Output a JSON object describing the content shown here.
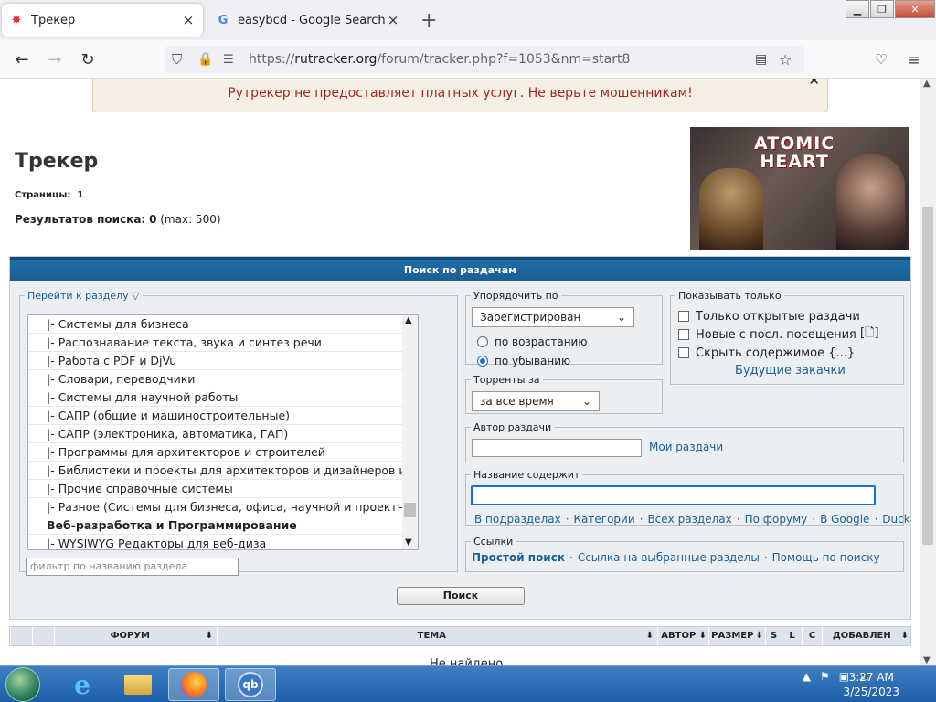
{
  "tabs": [
    {
      "title": "Трекер",
      "active": true
    },
    {
      "title": "easybcd - Google Search",
      "active": false
    }
  ],
  "address": {
    "prefix": "https://",
    "host": "rutracker.org",
    "path": "/forum/tracker.php?f=1053&nm=start8"
  },
  "notice": "Рутрекер не предоставляет платных услуг. Не верьте мошенникам!",
  "page": {
    "title": "Трекер",
    "pages_label": "Страницы:",
    "pages_value": "1",
    "results_label": "Результатов поиска:",
    "results_value": "0",
    "results_max": "(max: 500)"
  },
  "banner": {
    "line1": "ATOMIC",
    "line2": "HEART"
  },
  "search": {
    "header": "Поиск по раздачам",
    "goto_section": "Перейти к разделу",
    "forums": [
      {
        "label": "|- Системы для бизнеса",
        "cat": false
      },
      {
        "label": "|- Распознавание текста, звука и синтез речи",
        "cat": false
      },
      {
        "label": "|- Работа с PDF и DjVu",
        "cat": false
      },
      {
        "label": "|- Словари, переводчики",
        "cat": false
      },
      {
        "label": "|- Системы для научной работы",
        "cat": false
      },
      {
        "label": "|- САПР (общие и машиностроительные)",
        "cat": false
      },
      {
        "label": "|- САПР (электроника, автоматика, ГАП)",
        "cat": false
      },
      {
        "label": "|- Программы для архитекторов и строителей",
        "cat": false
      },
      {
        "label": "|- Библиотеки и проекты для архитекторов и дизайнеров и",
        "cat": false
      },
      {
        "label": "|- Прочие справочные системы",
        "cat": false
      },
      {
        "label": "|- Разное (Системы для бизнеса, офиса, научной и проектн",
        "cat": false
      },
      {
        "label": "Веб-разработка и Программирование",
        "cat": true
      },
      {
        "label": "|- WYSIWYG Редакторы для веб-диза",
        "cat": false
      }
    ],
    "filter_placeholder": "фильтр по названию раздела",
    "sort_legend": "Упорядочить по",
    "sort_value": "Зарегистрирован",
    "asc": "по возрастанию",
    "desc": "по убыванию",
    "period_legend": "Торренты за",
    "period_value": "за все время",
    "show_legend": "Показывать только",
    "only_open": "Только открытые раздачи",
    "new_since": "Новые с посл. посещения",
    "new_since_icon": "[🗋]",
    "hide_content": "Скрыть содержимое {...}",
    "future": "Будущие закачки",
    "author_legend": "Автор раздачи",
    "my_releases": "Мои раздачи",
    "title_legend": "Название содержит",
    "scope_links": [
      "В подразделах",
      "Категории",
      "Всех разделах",
      "По форуму",
      "В Google",
      "Duck"
    ],
    "links_legend": "Ссылки",
    "simple_search": "Простой поиск",
    "link_selected": "Ссылка на выбранные разделы",
    "help": "Помощь по поиску",
    "submit": "Поиск"
  },
  "table": {
    "columns": [
      "ФОРУМ",
      "ТЕМА",
      "АВТОР",
      "РАЗМЕР",
      "S",
      "L",
      "C",
      "ДОБАВЛЕН"
    ],
    "empty": "Не найдено"
  },
  "clock": {
    "time": "3:27 AM",
    "date": "3/25/2023"
  },
  "colors": {
    "accent": "#1a5f95",
    "notice_text": "#a62626",
    "header_bar": "#1f6ea6"
  }
}
